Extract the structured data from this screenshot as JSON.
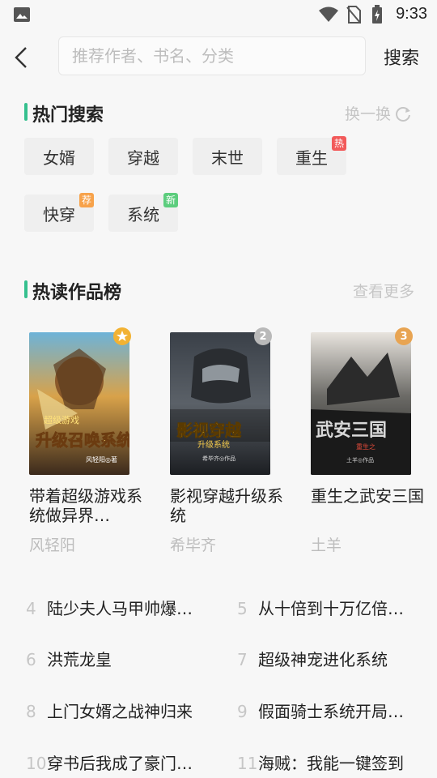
{
  "status": {
    "time": "9:33"
  },
  "search": {
    "placeholder": "推荐作者、书名、分类",
    "button": "搜索"
  },
  "hot_search": {
    "title": "热门搜索",
    "refresh_label": "换一换",
    "tags": [
      {
        "label": "女婿"
      },
      {
        "label": "穿越"
      },
      {
        "label": "末世"
      },
      {
        "label": "重生",
        "badge": "热",
        "badge_color": "#f25a5a"
      },
      {
        "label": "快穿",
        "badge": "荐",
        "badge_color": "#f7a24a"
      },
      {
        "label": "系统",
        "badge": "新",
        "badge_color": "#5ccd7d"
      }
    ]
  },
  "ranking": {
    "title": "热读作品榜",
    "more_label": "查看更多",
    "top": [
      {
        "rank": "1",
        "badge_icon": "star",
        "badge_color": "#f2b233",
        "title": "带着超级游戏系统做异界…",
        "author": "风轻阳",
        "cover": {
          "label_top": "超级游戏",
          "label_main": "升级召唤系统",
          "label_author": "风轻阳◎著"
        }
      },
      {
        "rank": "2",
        "badge_color": "#b9b9b9",
        "title": "影视穿越升级系统",
        "author": "希毕齐",
        "cover": {
          "label_main": "影视穿越",
          "label_sub": "升级系统",
          "label_author": "希毕齐◎作品"
        }
      },
      {
        "rank": "3",
        "badge_color": "#e8a452",
        "title": "重生之武安三国",
        "author": "土羊",
        "cover": {
          "label_main": "武安三国",
          "label_sub": "重生之",
          "label_author": "土羊◎作品"
        }
      }
    ],
    "list": [
      {
        "rank": "4",
        "title": "陆少夫人马甲帅爆…"
      },
      {
        "rank": "5",
        "title": "从十倍到十万亿倍…"
      },
      {
        "rank": "6",
        "title": "洪荒龙皇"
      },
      {
        "rank": "7",
        "title": "超级神宠进化系统"
      },
      {
        "rank": "8",
        "title": "上门女婿之战神归来"
      },
      {
        "rank": "9",
        "title": "假面骑士系统开局…"
      },
      {
        "rank": "10",
        "title": "穿书后我成了豪门…"
      },
      {
        "rank": "11",
        "title": "海贼：我能一键签到"
      }
    ]
  }
}
